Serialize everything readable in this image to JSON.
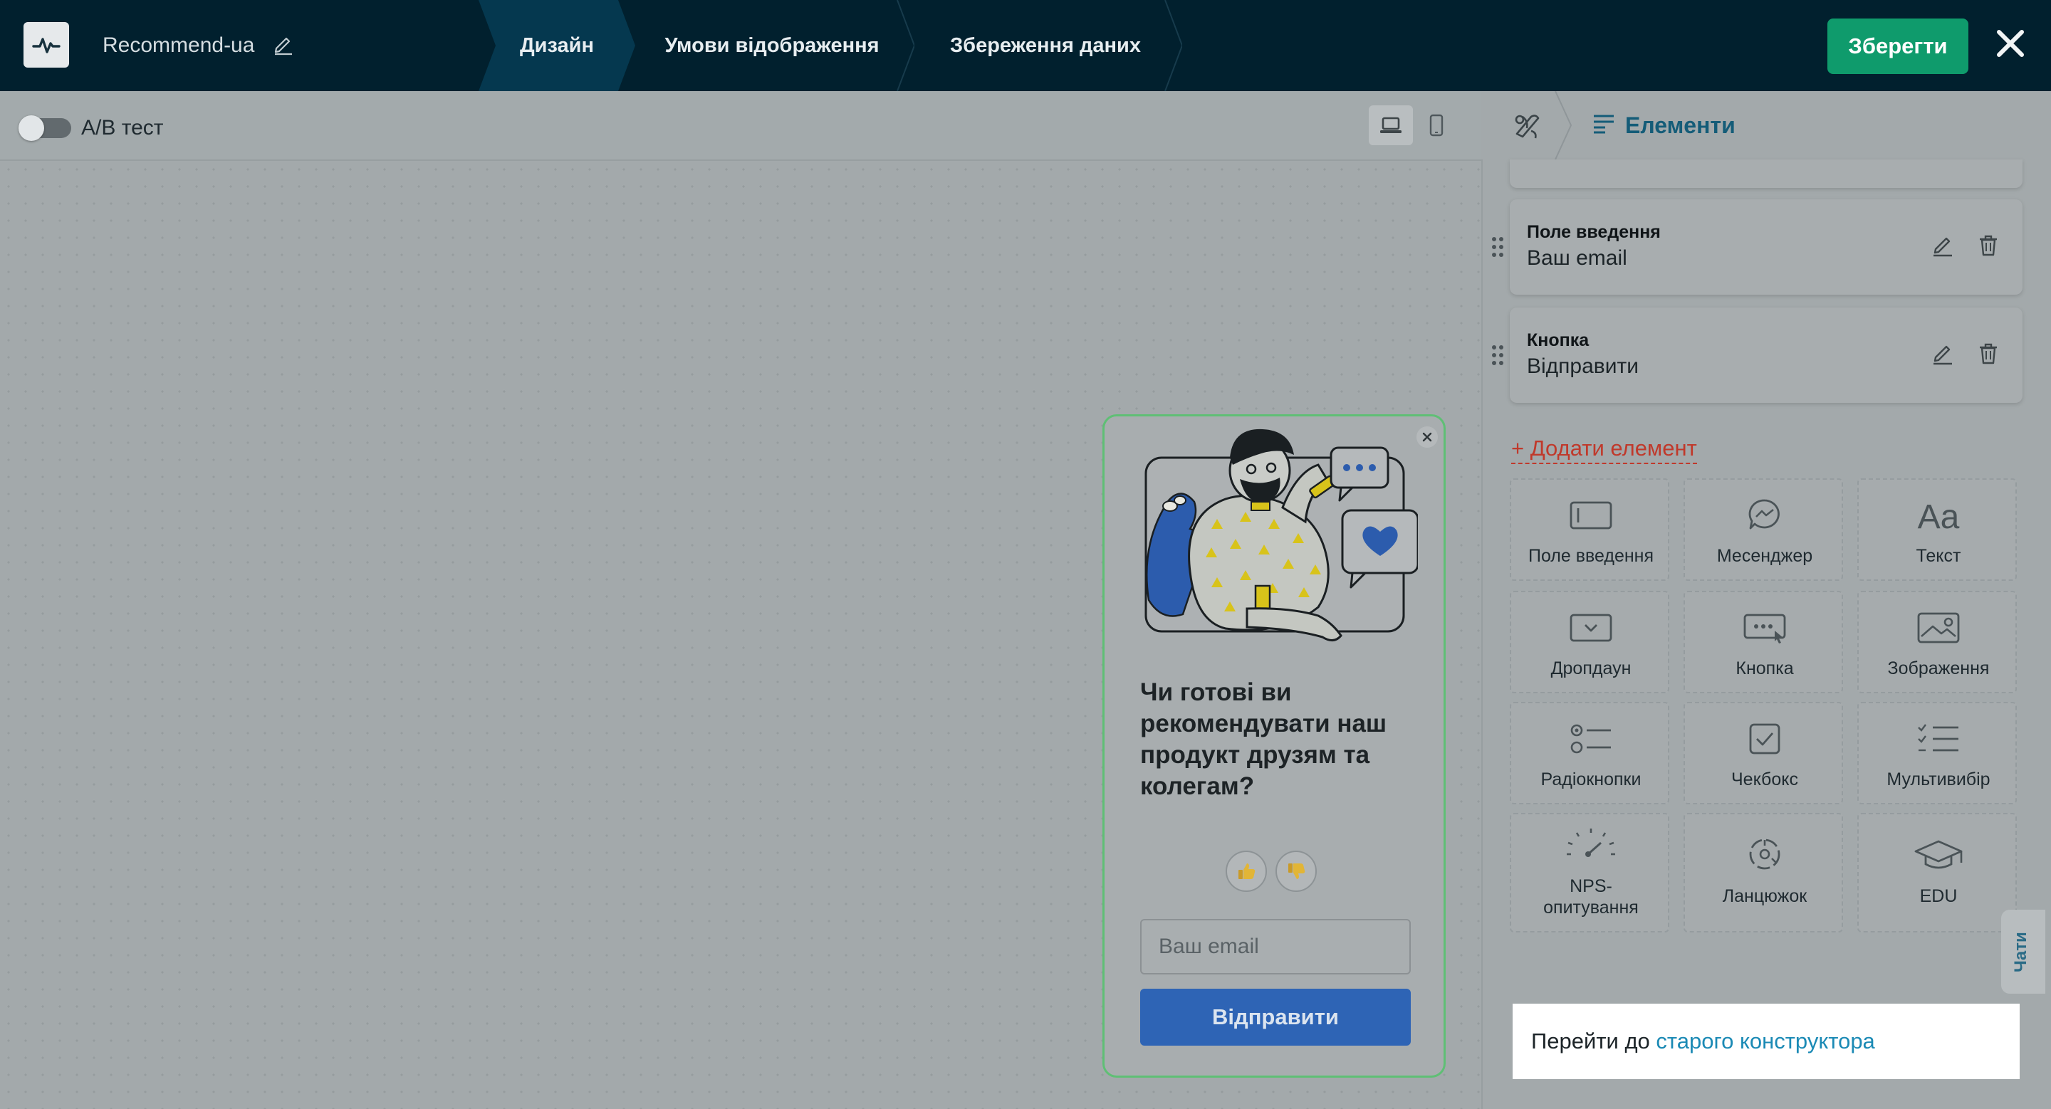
{
  "header": {
    "project_name": "Recommend-ua",
    "tabs": [
      {
        "label": "Дизайн",
        "active": true
      },
      {
        "label": "Умови відображення",
        "active": false
      },
      {
        "label": "Збереження даних",
        "active": false
      }
    ],
    "save_label": "Зберегти",
    "icons": {
      "logo": "pulse-logo-icon",
      "edit": "pencil-icon",
      "close": "close-icon"
    },
    "colors": {
      "background": "#01202e",
      "save": "#0f9b6c",
      "active_tab": "#05384f"
    }
  },
  "canvas_toolbar": {
    "ab_test_label": "A/B тест",
    "ab_test_enabled": false,
    "devices": [
      {
        "icon": "laptop-icon",
        "selected": true
      },
      {
        "icon": "mobile-icon",
        "selected": false
      }
    ]
  },
  "popup": {
    "question": "Чи готові ви рекомендувати наш продукт друзям та колегам?",
    "email_placeholder": "Ваш email",
    "submit_label": "Відправити",
    "border_color": "#5fbf75",
    "button_color": "#2e64b5"
  },
  "panel": {
    "title": "Елементи",
    "elements": [
      {
        "type": "Поле введення",
        "value": "Ваш email"
      },
      {
        "type": "Кнопка",
        "value": "Відправити"
      }
    ],
    "add_element_label": "+ Додати елемент",
    "tiles": [
      {
        "label": "Поле введення",
        "icon": "input-field-icon"
      },
      {
        "label": "Месенджер",
        "icon": "messenger-icon"
      },
      {
        "label": "Текст",
        "icon": "text-icon"
      },
      {
        "label": "Дропдаун",
        "icon": "dropdown-icon"
      },
      {
        "label": "Кнопка",
        "icon": "button-icon"
      },
      {
        "label": "Зображення",
        "icon": "image-icon"
      },
      {
        "label": "Радіокнопки",
        "icon": "radio-icon"
      },
      {
        "label": "Чекбокс",
        "icon": "checkbox-icon"
      },
      {
        "label": "Мультивибір",
        "icon": "multiselect-icon"
      },
      {
        "label": "NPS-опитування",
        "label_line1": "NPS-",
        "label_line2": "опитування",
        "icon": "nps-gauge-icon"
      },
      {
        "label": "Ланцюжок",
        "icon": "chain-icon"
      },
      {
        "label": "EDU",
        "icon": "graduation-cap-icon"
      }
    ],
    "chat_tab_label": "Чати",
    "old_builder_prefix": "Перейти до",
    "old_builder_link": "старого конструктора"
  }
}
